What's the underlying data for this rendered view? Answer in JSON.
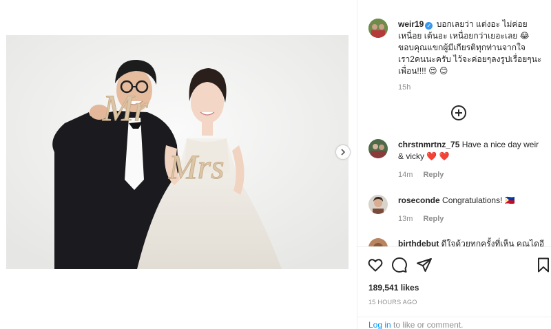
{
  "post": {
    "username": "weir19",
    "caption": "บอกเลยว่า แต่งอะ ไม่ค่อยเหนื่อย เต้นอะ เหนื่อยกว่าเยอะเลย 😂 ขอบคุณแขกผู้มีเกียรติทุกท่านจากใจเรา2คนนะครับ ไว้จะค่อยๆลงรูปเรื่อยๆนะเพื่อน!!!! 😍 😊",
    "caption_time": "15h",
    "photo_alt": "Wedding photo of a couple holding Mr and Mrs signs"
  },
  "comments": [
    {
      "username": "chrstnmrtnz_75",
      "text": "Have a nice day weir & vicky ❤️ ❤️",
      "time": "14m",
      "reply": "Reply"
    },
    {
      "username": "roseconde",
      "text": "Congratulations! 🇵🇭",
      "time": "13m",
      "reply": "Reply"
    },
    {
      "username": "birthdebut",
      "text": "ดีใจด้วยทุกครั้งที่เห็น คุณไดอี",
      "time": "",
      "reply": ""
    }
  ],
  "actions": {
    "likes": "189,541 likes",
    "posted": "15 HOURS AGO",
    "login_link": "Log in",
    "login_rest": " to like or comment."
  },
  "colors": {
    "link": "#0095f6",
    "verified": "#3897f0",
    "heart": "#ed4956"
  },
  "icons": [
    "chevron-right-icon",
    "verified-badge-icon",
    "plus-circle-icon",
    "heart-icon",
    "comment-icon",
    "share-icon",
    "bookmark-icon"
  ]
}
